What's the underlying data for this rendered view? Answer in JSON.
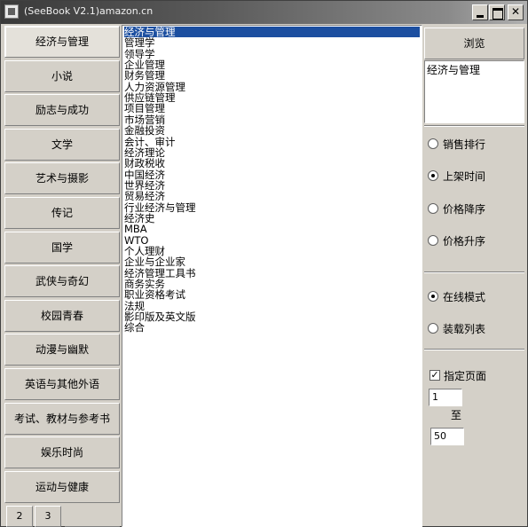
{
  "window": {
    "title": "(SeeBook V2.1)amazon.cn"
  },
  "categories": [
    "经济与管理",
    "小说",
    "励志与成功",
    "文学",
    "艺术与摄影",
    "传记",
    "国学",
    "武侠与奇幻",
    "校园青春",
    "动漫与幽默",
    "英语与其他外语",
    "考试、教材与参考书",
    "娱乐时尚",
    "运动与健康"
  ],
  "active_category": "经济与管理",
  "page_tabs": [
    "2",
    "3"
  ],
  "list_items": [
    "经济与管理",
    "管理学",
    "领导学",
    "企业管理",
    "财务管理",
    "人力资源管理",
    "供应链管理",
    "项目管理",
    "市场营销",
    "金融投资",
    "会计、审计",
    "经济理论",
    "财政税收",
    "中国经济",
    "世界经济",
    "贸易经济",
    "行业经济与管理",
    "经济史",
    "MBA",
    "WTO",
    "个人理财",
    "企业与企业家",
    "经济管理工具书",
    "商务实务",
    "职业资格考试",
    "法规",
    "影印版及英文版",
    "综合"
  ],
  "selected_item": "经济与管理",
  "right_panel": {
    "browse_label": "浏览",
    "preview_text": "经济与管理",
    "sort_options": [
      {
        "label": "销售排行",
        "checked": false
      },
      {
        "label": "上架时间",
        "checked": true
      },
      {
        "label": "价格降序",
        "checked": false
      },
      {
        "label": "价格升序",
        "checked": false
      }
    ],
    "mode_options": [
      {
        "label": "在线模式",
        "checked": true
      },
      {
        "label": "装载列表",
        "checked": false
      }
    ],
    "page_checkbox_label": "指定页面",
    "page_checkbox_checked": true,
    "page_from": "1",
    "page_to_label": "至",
    "page_to": "50"
  }
}
